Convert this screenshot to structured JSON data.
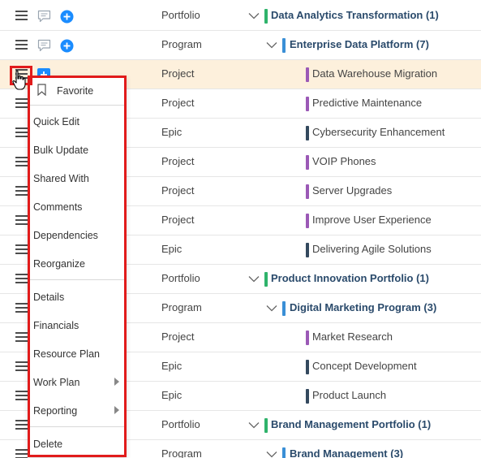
{
  "rows": [
    {
      "type": "Portfolio",
      "name": "Data Analytics Transformation (1)"
    },
    {
      "type": "Program",
      "name": "Enterprise Data Platform (7)"
    },
    {
      "type": "Project",
      "name": "Data Warehouse Migration"
    },
    {
      "type": "Project",
      "name": "Predictive Maintenance"
    },
    {
      "type": "Epic",
      "name": "Cybersecurity Enhancement"
    },
    {
      "type": "Project",
      "name": "VOIP Phones"
    },
    {
      "type": "Project",
      "name": "Server Upgrades"
    },
    {
      "type": "Project",
      "name": "Improve User Experience"
    },
    {
      "type": "Epic",
      "name": "Delivering Agile Solutions"
    },
    {
      "type": "Portfolio",
      "name": "Product Innovation Portfolio (1)"
    },
    {
      "type": "Program",
      "name": "Digital Marketing Program (3)"
    },
    {
      "type": "Project",
      "name": "Market Research"
    },
    {
      "type": "Epic",
      "name": "Concept Development"
    },
    {
      "type": "Epic",
      "name": "Product Launch"
    },
    {
      "type": "Portfolio",
      "name": "Brand Management Portfolio (1)"
    },
    {
      "type": "Program",
      "name": "Brand Management (3)"
    }
  ],
  "menu": {
    "favorite": "Favorite",
    "quick_edit": "Quick Edit",
    "bulk_update": "Bulk Update",
    "shared_with": "Shared With",
    "comments": "Comments",
    "dependencies": "Dependencies",
    "reorganize": "Reorganize",
    "details": "Details",
    "financials": "Financials",
    "resource_plan": "Resource Plan",
    "work_plan": "Work Plan",
    "reporting": "Reporting",
    "delete": "Delete"
  },
  "colors": {
    "portfolio": "#2fb36b",
    "program": "#3a8fd6",
    "project": "#9b59b6",
    "epic": "#34495e",
    "highlight": "#fdf0dc",
    "accent_blue": "#1a8cff",
    "outline_red": "#e11b1b"
  },
  "icons": {
    "row_menu": "hamburger-icon",
    "comment": "comment-icon",
    "add": "add-circle-icon",
    "expand": "chevron-down-icon",
    "favorite": "bookmark-icon",
    "submenu": "caret-right-icon",
    "cursor": "hand-pointer-icon"
  }
}
